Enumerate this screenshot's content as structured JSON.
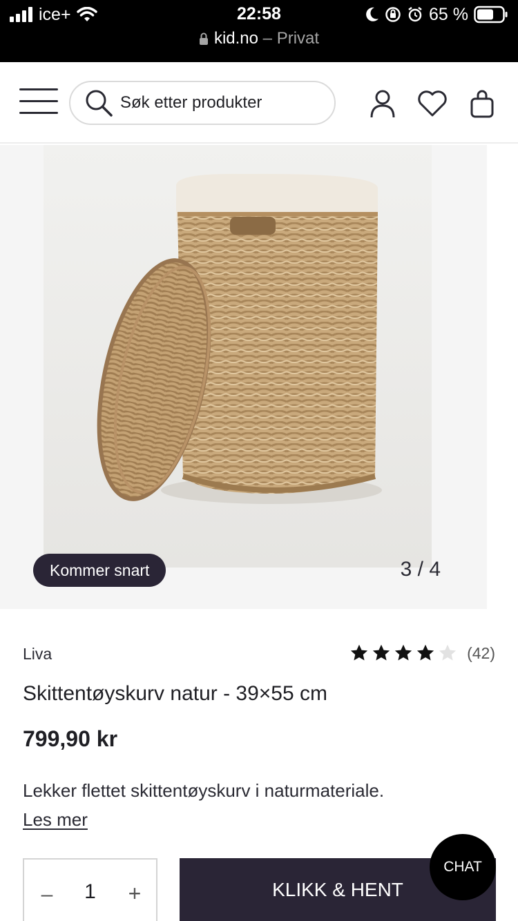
{
  "status_bar": {
    "carrier": "ice+",
    "time": "22:58",
    "battery": "65 %",
    "url": "kid.no",
    "browsing_mode": "– Privat"
  },
  "header": {
    "search_placeholder": "Søk etter produkter",
    "icons": [
      "menu-icon",
      "search-icon",
      "user-icon",
      "heart-icon",
      "bag-icon"
    ]
  },
  "gallery": {
    "badge": "Kommer snart",
    "counter": "3 / 4"
  },
  "product": {
    "brand": "Liva",
    "rating": 4,
    "rating_max": 5,
    "rating_count": "(42)",
    "title": "Skittentøyskurv natur - 39×55 cm",
    "price": "799,90 kr",
    "description": "Lekker flettet skittentøyskurv i naturmateriale.",
    "read_more": "Les mer"
  },
  "actions": {
    "quantity": "1",
    "minus": "–",
    "plus": "+",
    "cta": "KLIKK & HENT",
    "chat": "CHAT"
  },
  "colors": {
    "dark_accent": "#2a2536",
    "star_filled": "#111111",
    "star_empty": "#e2e2e2"
  }
}
